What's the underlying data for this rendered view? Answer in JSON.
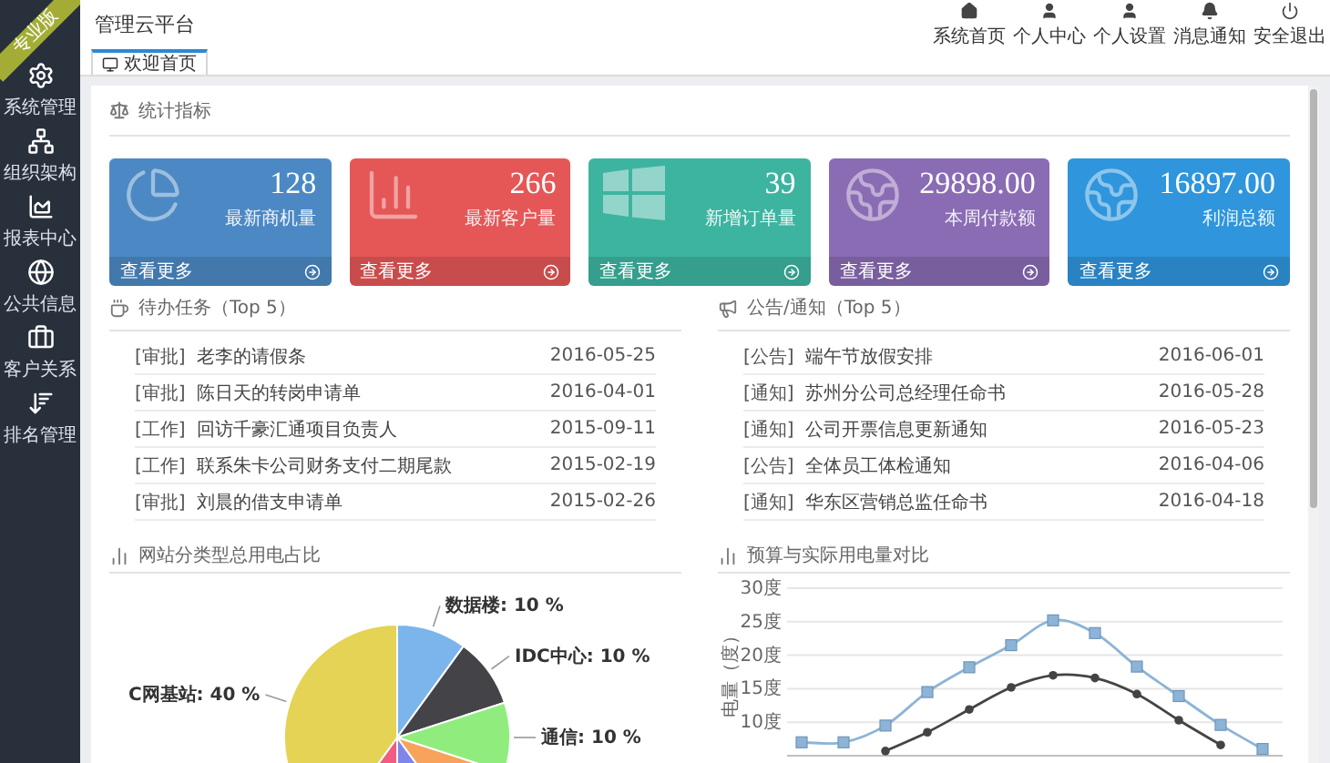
{
  "sidebar": {
    "badge": "专业版",
    "items": [
      {
        "label": "系统管理"
      },
      {
        "label": "组织架构"
      },
      {
        "label": "报表中心"
      },
      {
        "label": "公共信息"
      },
      {
        "label": "客户关系"
      },
      {
        "label": "排名管理"
      }
    ]
  },
  "header": {
    "title": "管理云平台",
    "nav": [
      {
        "label": "系统首页"
      },
      {
        "label": "个人中心"
      },
      {
        "label": "个人设置"
      },
      {
        "label": "消息通知"
      },
      {
        "label": "安全退出"
      }
    ]
  },
  "tabs": [
    {
      "label": "欢迎首页",
      "selected": true
    }
  ],
  "stats": {
    "title": "统计指标",
    "cards": [
      {
        "value": "128",
        "label": "最新商机量",
        "link": "查看更多",
        "color": "#4c89c4"
      },
      {
        "value": "266",
        "label": "最新客户量",
        "link": "查看更多",
        "color": "#e55757"
      },
      {
        "value": "39",
        "label": "新增订单量",
        "link": "查看更多",
        "color": "#3db4a0"
      },
      {
        "value": "29898.00",
        "label": "本周付款额",
        "link": "查看更多",
        "color": "#8a6cb4"
      },
      {
        "value": "16897.00",
        "label": "利润总额",
        "link": "查看更多",
        "color": "#2f95dc"
      }
    ]
  },
  "tasks": {
    "title": "待办任务（Top 5）",
    "rows": [
      {
        "tag": "[审批]",
        "text": "老李的请假条",
        "date": "2016-05-25"
      },
      {
        "tag": "[审批]",
        "text": "陈日天的转岗申请单",
        "date": "2016-04-01"
      },
      {
        "tag": "[工作]",
        "text": "回访千豪汇通项目负责人",
        "date": "2015-09-11"
      },
      {
        "tag": "[工作]",
        "text": "联系朱卡公司财务支付二期尾款",
        "date": "2015-02-19"
      },
      {
        "tag": "[审批]",
        "text": "刘晨的借支申请单",
        "date": "2015-02-26"
      }
    ]
  },
  "notices": {
    "title": "公告/通知（Top 5）",
    "rows": [
      {
        "tag": "[公告]",
        "text": "端午节放假安排",
        "date": "2016-06-01"
      },
      {
        "tag": "[通知]",
        "text": "苏州分公司总经理任命书",
        "date": "2016-05-28"
      },
      {
        "tag": "[通知]",
        "text": "公司开票信息更新通知",
        "date": "2016-05-23"
      },
      {
        "tag": "[公告]",
        "text": "全体员工体检通知",
        "date": "2016-04-06"
      },
      {
        "tag": "[通知]",
        "text": "华东区营销总监任命书",
        "date": "2016-04-18"
      }
    ]
  },
  "pie_panel": {
    "title": "网站分类型总用电占比",
    "chart_data": {
      "type": "pie",
      "values": [
        10,
        10,
        10,
        10,
        10,
        10,
        40
      ],
      "colors": [
        "#7cb5ec",
        "#434348",
        "#90ed7d",
        "#f7a35c",
        "#8085e9",
        "#f15c80",
        "#e4d354"
      ],
      "value_labels": [
        "数据楼: 10 %",
        "IDC中心: 10 %",
        "通信: 10 %",
        null,
        null,
        null,
        "C网基站: 40 %"
      ]
    }
  },
  "line_panel": {
    "title": "预算与实际用电量对比",
    "chart_data": {
      "type": "line",
      "ylabel": "电量（度）",
      "grid": true,
      "ylim": [
        5,
        30
      ],
      "yticks": [
        {
          "value": 10,
          "label": "10度"
        },
        {
          "value": 15,
          "label": "15度"
        },
        {
          "value": 20,
          "label": "20度"
        },
        {
          "value": 25,
          "label": "25度"
        },
        {
          "value": 30,
          "label": "30度"
        }
      ],
      "series": [
        {
          "color": "#8db4d6",
          "marker": "square",
          "values": [
            7,
            7,
            9.5,
            14.5,
            18.2,
            21.5,
            25.2,
            23.3,
            18.3,
            13.9,
            9.6,
            6
          ]
        },
        {
          "color": "#444444",
          "marker": "circle",
          "values": [
            null,
            null,
            5.7,
            8.5,
            11.9,
            15.2,
            17,
            16.6,
            14.2,
            10.3,
            6.6,
            null
          ]
        }
      ]
    }
  }
}
